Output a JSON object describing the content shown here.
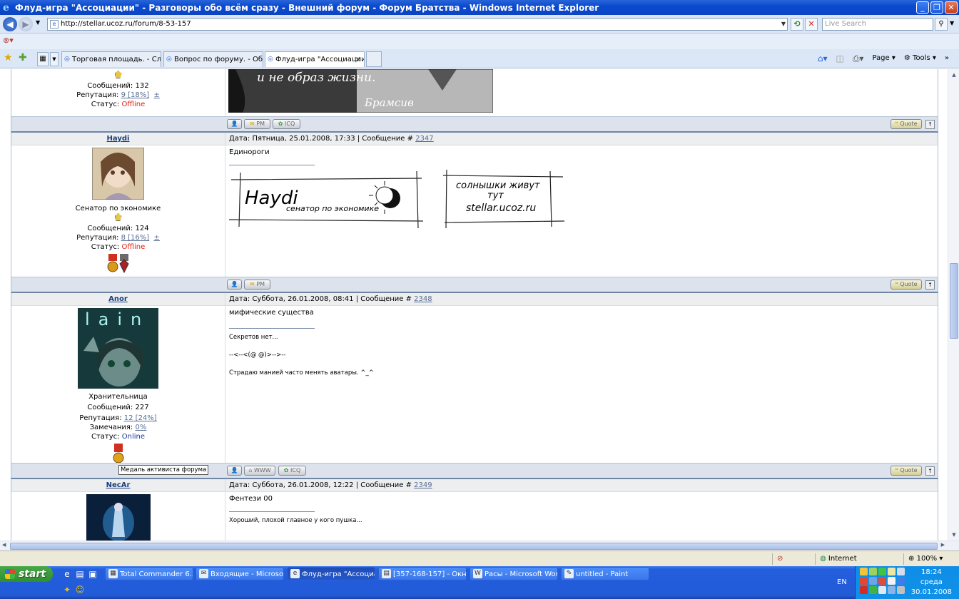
{
  "window": {
    "title": "Флуд-игра \"Ассоциации\" - Разговоры обо всём сразу - Внешний форум - Форум Братства - Windows Internet Explorer"
  },
  "address": {
    "url": "http://stellar.ucoz.ru/forum/8-53-157",
    "search_placeholder": "Live Search"
  },
  "tabs": [
    {
      "label": "Торговая площадь. - Слав..."
    },
    {
      "label": "Вопрос по форуму. - Общие..."
    },
    {
      "label": "Флуд-игра \"Ассоциации...",
      "active": true
    }
  ],
  "commands": {
    "page": "Page",
    "tools": "Tools"
  },
  "top_post": {
    "messages": "Сообщений: 132",
    "rep_label": "Репутация:",
    "rep_value": "9 [18%]",
    "pm": "±",
    "status_label": "Статус:",
    "status": "Offline",
    "signature_text": "и не образ жизни.",
    "signature_author": "Брамсив"
  },
  "buttons": {
    "pm": "PM",
    "icq": "ICQ",
    "www": "WWW",
    "quote": "Quote"
  },
  "posts": [
    {
      "user": "Haydi",
      "header": "Дата: Пятница, 25.01.2008, 17:33 | Сообщение #",
      "msg_no": "2347",
      "rank": "Сенатор по экономике",
      "messages": "Сообщений: 124",
      "rep_label": "Репутация:",
      "rep_value": "8 [16%]",
      "pm": "±",
      "status_label": "Статус:",
      "status": "Offline",
      "text": "Единороги",
      "sig1_name": "Haydi",
      "sig1_sub": "сенатор по экономике",
      "sig2_line1": "солнышки живут",
      "sig2_line2": "тут",
      "sig2_line3": "stellar.ucoz.ru"
    },
    {
      "user": "Anor",
      "header": "Дата: Суббота, 26.01.2008, 08:41 | Сообщение #",
      "msg_no": "2348",
      "avatar_text": "lain",
      "rank": "Хранительница",
      "messages": "Сообщений: 227",
      "rep_label": "Репутация:",
      "rep_value": "12 [24%]",
      "warn_label": "Замечания:",
      "warn_value": "0%",
      "status_label": "Статус:",
      "status": "Online",
      "text": "мифические существа",
      "sig_l1": "Секретов нет...",
      "sig_l2": "--<--<(@ @)>-->--",
      "sig_l3": "Страдаю манией часто менять аватары. ^_^",
      "tooltip": "Медаль активиста форума"
    },
    {
      "user": "NecAr",
      "header": "Дата: Суббота, 26.01.2008, 12:22 | Сообщение #",
      "msg_no": "2349",
      "text": "Фентези 00",
      "sig_l1": "Хороший, плохой главное у кого пушка..."
    }
  ],
  "statusbar": {
    "zone": "Internet",
    "zoom": "100%"
  },
  "taskbar": {
    "start": "start",
    "tasks": [
      {
        "label": "Total Commander 6.5..."
      },
      {
        "label": "Входящие - Microsof..."
      },
      {
        "label": "Флуд-игра \"Ассоциа...",
        "active": true
      },
      {
        "label": "[357-168-157] - Окн..."
      },
      {
        "label": "Расы - Microsoft Word"
      },
      {
        "label": "untitled - Paint"
      }
    ],
    "lang": "EN",
    "time": "18:24",
    "day": "среда",
    "date": "30.01.2008"
  }
}
